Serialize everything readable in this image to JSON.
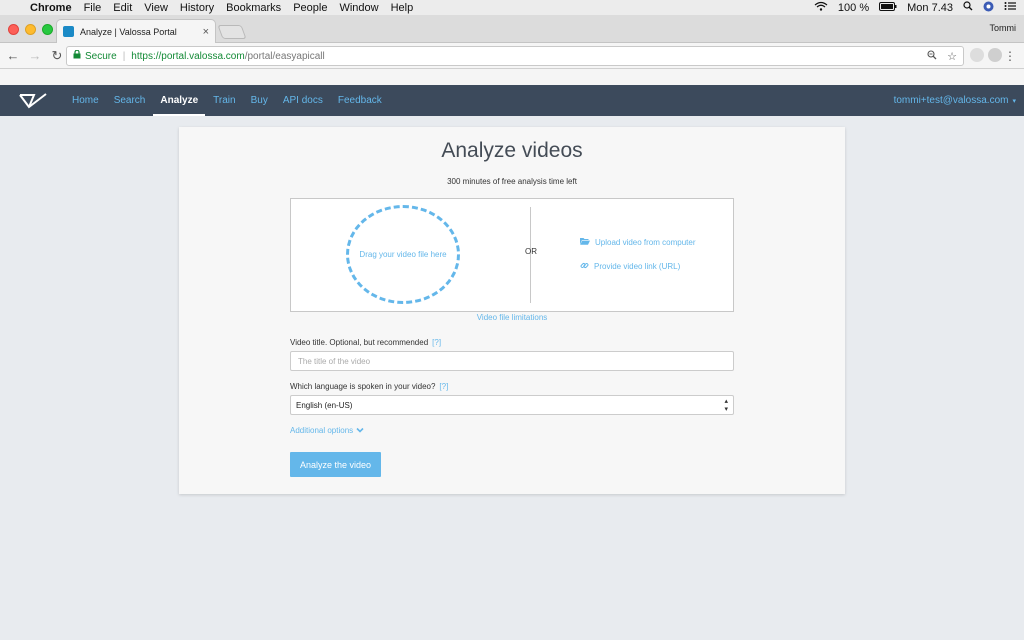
{
  "menubar": {
    "app_name": "Chrome",
    "items": [
      "File",
      "Edit",
      "View",
      "History",
      "Bookmarks",
      "People",
      "Window",
      "Help"
    ],
    "battery": "100 %",
    "clock": "Mon 7.43"
  },
  "browser": {
    "tab_title": "Analyze | Valossa Portal",
    "profile_name": "Tommi",
    "secure_label": "Secure",
    "url_scheme_host": "https://portal.valossa.com",
    "url_path": "/portal/easyapicall"
  },
  "navbar": {
    "links": [
      "Home",
      "Search",
      "Analyze",
      "Train",
      "Buy",
      "API docs",
      "Feedback"
    ],
    "active_index": 2,
    "user": "tommi+test@valossa.com"
  },
  "card": {
    "title": "Analyze videos",
    "subtitle": "300 minutes of free analysis time left",
    "drop_text": "Drag your video file here",
    "or_text": "OR",
    "upload_text": "Upload video from computer",
    "url_text": "Provide video link (URL)",
    "limits_text": "Video file limitations",
    "title_label": "Video title. Optional, but recommended",
    "help_text": "[?]",
    "title_placeholder": "The title of the video",
    "language_label": "Which language is spoken in your video?",
    "language_value": "English (en-US)",
    "additional_options": "Additional options",
    "submit_label": "Analyze the video"
  },
  "colors": {
    "accent": "#64b7ea",
    "navbar_bg": "#3c4a5c",
    "page_bg": "#e8ebef"
  }
}
